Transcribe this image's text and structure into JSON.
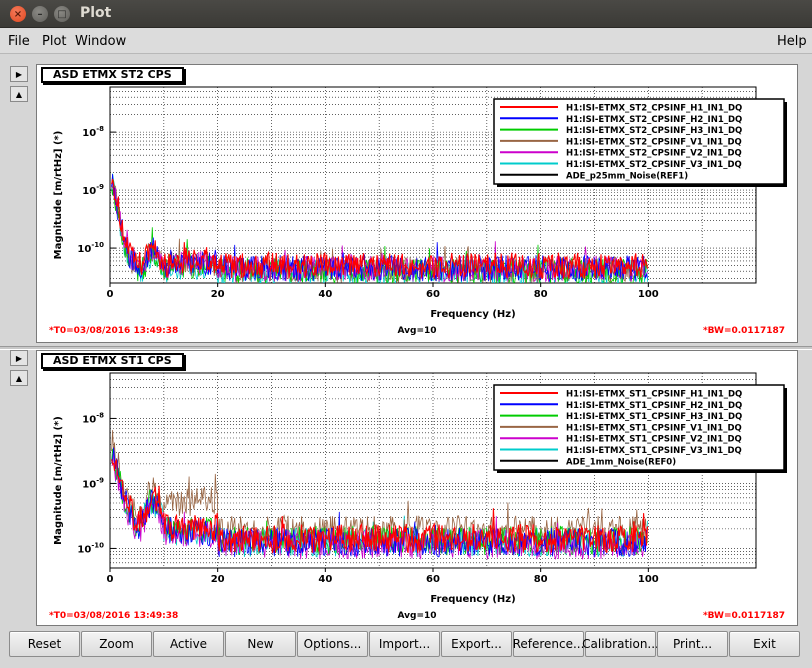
{
  "window": {
    "title": "Plot"
  },
  "menu": {
    "file": "File",
    "plot": "Plot",
    "window": "Window",
    "help": "Help"
  },
  "buttons": [
    "Reset",
    "Zoom",
    "Active",
    "New",
    "Options...",
    "Import...",
    "Export...",
    "Reference...",
    "Calibration...",
    "Print...",
    "Exit"
  ],
  "colors": {
    "red": "#ff0000",
    "blue": "#0000ff",
    "green": "#00cc00",
    "brown": "#996644",
    "magenta": "#cc00cc",
    "cyan": "#00cccc",
    "black": "#000000"
  },
  "chart_data": [
    {
      "type": "line",
      "title": "ASD ETMX ST2 CPS",
      "xlabel": "Frequency (Hz)",
      "ylabel": "Magnitude [m/rtHz] (*)",
      "xlim": [
        0,
        120
      ],
      "ylog": true,
      "xticks": [
        0,
        20,
        40,
        60,
        80,
        100
      ],
      "ytick_labels": [
        "10^-8",
        "10^-9",
        "10^-10"
      ],
      "yticks": [
        1e-08,
        1e-09,
        1e-10
      ],
      "footer_left": "*T0=03/08/2016 13:49:38",
      "footer_center": "Avg=10",
      "footer_right": "*BW=0.0117187",
      "legend_placement": "top-right",
      "series": [
        {
          "name": "H1:ISI-ETMX_ST2_CPSINF_H1_IN1_DQ",
          "color": "#ff0000",
          "level": 5e-11
        },
        {
          "name": "H1:ISI-ETMX_ST2_CPSINF_H2_IN1_DQ",
          "color": "#0000ff",
          "level": 4.5e-11
        },
        {
          "name": "H1:ISI-ETMX_ST2_CPSINF_H3_IN1_DQ",
          "color": "#00cc00",
          "level": 4e-11
        },
        {
          "name": "H1:ISI-ETMX_ST2_CPSINF_V1_IN1_DQ",
          "color": "#996644",
          "level": 4.2e-11
        },
        {
          "name": "H1:ISI-ETMX_ST2_CPSINF_V2_IN1_DQ",
          "color": "#cc00cc",
          "level": 4.4e-11
        },
        {
          "name": "H1:ISI-ETMX_ST2_CPSINF_V3_IN1_DQ",
          "color": "#00cccc",
          "level": 3.8e-11
        },
        {
          "name": "ADE_p25mm_Noise(REF1)",
          "color": "#000000",
          "level": null
        }
      ]
    },
    {
      "type": "line",
      "title": "ASD ETMX ST1 CPS",
      "xlabel": "Frequency (Hz)",
      "ylabel": "Magnitude [m/rtHz] (*)",
      "xlim": [
        0,
        120
      ],
      "ylog": true,
      "xticks": [
        0,
        20,
        40,
        60,
        80,
        100
      ],
      "ytick_labels": [
        "10^-8",
        "10^-9",
        "10^-10"
      ],
      "yticks": [
        1e-08,
        1e-09,
        1e-10
      ],
      "footer_left": "*T0=03/08/2016 13:49:38",
      "footer_center": "Avg=10",
      "footer_right": "*BW=0.0117187",
      "legend_placement": "top-right",
      "series": [
        {
          "name": "H1:ISI-ETMX_ST1_CPSINF_H1_IN1_DQ",
          "color": "#ff0000",
          "level": 1.5e-10
        },
        {
          "name": "H1:ISI-ETMX_ST1_CPSINF_H2_IN1_DQ",
          "color": "#0000ff",
          "level": 1.3e-10
        },
        {
          "name": "H1:ISI-ETMX_ST1_CPSINF_H3_IN1_DQ",
          "color": "#00cc00",
          "level": 1.4e-10
        },
        {
          "name": "H1:ISI-ETMX_ST1_CPSINF_V1_IN1_DQ",
          "color": "#996644",
          "level": 2e-10
        },
        {
          "name": "H1:ISI-ETMX_ST1_CPSINF_V2_IN1_DQ",
          "color": "#cc00cc",
          "level": 1.2e-10
        },
        {
          "name": "H1:ISI-ETMX_ST1_CPSINF_V3_IN1_DQ",
          "color": "#00cccc",
          "level": 1.3e-10
        },
        {
          "name": "ADE_1mm_Noise(REF0)",
          "color": "#000000",
          "level": null
        }
      ]
    }
  ]
}
